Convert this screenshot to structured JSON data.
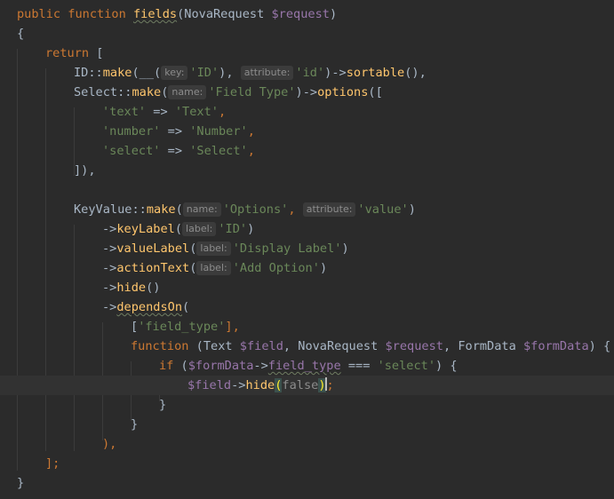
{
  "editor": {
    "lines": [
      [
        {
          "t": "public",
          "c": "kw"
        },
        {
          "t": " ",
          "c": ""
        },
        {
          "t": "function",
          "c": "kw"
        },
        {
          "t": " ",
          "c": ""
        },
        {
          "t": "fields",
          "c": "fn sq"
        },
        {
          "t": "(NovaRequest ",
          "c": ""
        },
        {
          "t": "$request",
          "c": "var"
        },
        {
          "t": ")",
          "c": ""
        }
      ],
      [
        {
          "t": "{",
          "c": ""
        }
      ],
      [
        {
          "t": "return",
          "c": "kw"
        },
        {
          "t": " [",
          "c": ""
        }
      ],
      [
        {
          "t": "ID::",
          "c": ""
        },
        {
          "t": "make",
          "c": "fn"
        },
        {
          "t": "(__(",
          "c": ""
        },
        {
          "t": "key:",
          "c": "hint"
        },
        {
          "t": "'ID'",
          "c": "str"
        },
        {
          "t": "), ",
          "c": ""
        },
        {
          "t": "attribute:",
          "c": "hint"
        },
        {
          "t": "'id'",
          "c": "str"
        },
        {
          "t": ")->",
          "c": ""
        },
        {
          "t": "sortable",
          "c": "fn"
        },
        {
          "t": "(),",
          "c": ""
        }
      ],
      [
        {
          "t": "Select::",
          "c": ""
        },
        {
          "t": "make",
          "c": "fn"
        },
        {
          "t": "(",
          "c": ""
        },
        {
          "t": "name:",
          "c": "hint"
        },
        {
          "t": "'Field Type'",
          "c": "str"
        },
        {
          "t": ")->",
          "c": ""
        },
        {
          "t": "options",
          "c": "fn"
        },
        {
          "t": "([",
          "c": ""
        }
      ],
      [
        {
          "t": "'text'",
          "c": "str"
        },
        {
          "t": " => ",
          "c": ""
        },
        {
          "t": "'Text'",
          "c": "str"
        },
        {
          "t": ",",
          "c": "kw"
        }
      ],
      [
        {
          "t": "'number'",
          "c": "str"
        },
        {
          "t": " => ",
          "c": ""
        },
        {
          "t": "'Number'",
          "c": "str"
        },
        {
          "t": ",",
          "c": "kw"
        }
      ],
      [
        {
          "t": "'select'",
          "c": "str"
        },
        {
          "t": " => ",
          "c": ""
        },
        {
          "t": "'Select'",
          "c": "str"
        },
        {
          "t": ",",
          "c": "kw"
        }
      ],
      [
        {
          "t": "]),",
          "c": ""
        }
      ],
      [],
      [
        {
          "t": "KeyValue::",
          "c": ""
        },
        {
          "t": "make",
          "c": "fn"
        },
        {
          "t": "(",
          "c": ""
        },
        {
          "t": "name:",
          "c": "hint"
        },
        {
          "t": "'Options'",
          "c": "str"
        },
        {
          "t": ", ",
          "c": "kw"
        },
        {
          "t": "attribute:",
          "c": "hint"
        },
        {
          "t": "'value'",
          "c": "str"
        },
        {
          "t": ")",
          "c": ""
        }
      ],
      [
        {
          "t": "->",
          "c": ""
        },
        {
          "t": "keyLabel",
          "c": "fn"
        },
        {
          "t": "(",
          "c": ""
        },
        {
          "t": "label:",
          "c": "hint"
        },
        {
          "t": "'ID'",
          "c": "str"
        },
        {
          "t": ")",
          "c": ""
        }
      ],
      [
        {
          "t": "->",
          "c": ""
        },
        {
          "t": "valueLabel",
          "c": "fn"
        },
        {
          "t": "(",
          "c": ""
        },
        {
          "t": "label:",
          "c": "hint"
        },
        {
          "t": "'Display Label'",
          "c": "str"
        },
        {
          "t": ")",
          "c": ""
        }
      ],
      [
        {
          "t": "->",
          "c": ""
        },
        {
          "t": "actionText",
          "c": "fn"
        },
        {
          "t": "(",
          "c": ""
        },
        {
          "t": "label:",
          "c": "hint"
        },
        {
          "t": "'Add Option'",
          "c": "str"
        },
        {
          "t": ")",
          "c": ""
        }
      ],
      [
        {
          "t": "->",
          "c": ""
        },
        {
          "t": "hide",
          "c": "fn"
        },
        {
          "t": "()",
          "c": ""
        }
      ],
      [
        {
          "t": "->",
          "c": ""
        },
        {
          "t": "dependsOn",
          "c": "fn sq"
        },
        {
          "t": "(",
          "c": ""
        }
      ],
      [
        {
          "t": "[",
          "c": ""
        },
        {
          "t": "'field_type'",
          "c": "str"
        },
        {
          "t": "],",
          "c": "kw"
        }
      ],
      [
        {
          "t": "function",
          "c": "kw"
        },
        {
          "t": " (Text ",
          "c": ""
        },
        {
          "t": "$field",
          "c": "var"
        },
        {
          "t": ", NovaRequest ",
          "c": ""
        },
        {
          "t": "$request",
          "c": "var"
        },
        {
          "t": ", FormData ",
          "c": ""
        },
        {
          "t": "$formData",
          "c": "var"
        },
        {
          "t": ") {",
          "c": ""
        }
      ],
      [
        {
          "t": "if",
          "c": "kw"
        },
        {
          "t": " (",
          "c": ""
        },
        {
          "t": "$formData",
          "c": "var"
        },
        {
          "t": "->",
          "c": ""
        },
        {
          "t": "field_type",
          "c": "var sq"
        },
        {
          "t": " === ",
          "c": ""
        },
        {
          "t": "'select'",
          "c": "str"
        },
        {
          "t": ") {",
          "c": ""
        }
      ],
      [
        {
          "t": "$field",
          "c": "var"
        },
        {
          "t": "->",
          "c": ""
        },
        {
          "t": "hide",
          "c": "fn"
        },
        {
          "t": "(",
          "c": "bm"
        },
        {
          "t": "false",
          "c": "lit-false"
        },
        {
          "t": ")",
          "c": "bm"
        },
        {
          "t": "",
          "c": "caret"
        },
        {
          "t": ";",
          "c": "kw"
        }
      ],
      [
        {
          "t": "}",
          "c": ""
        }
      ],
      [
        {
          "t": "}",
          "c": ""
        }
      ],
      [
        {
          "t": "),",
          "c": "kw"
        }
      ],
      [
        {
          "t": "];",
          "c": "kw"
        }
      ],
      [
        {
          "t": "}",
          "c": ""
        }
      ]
    ]
  }
}
